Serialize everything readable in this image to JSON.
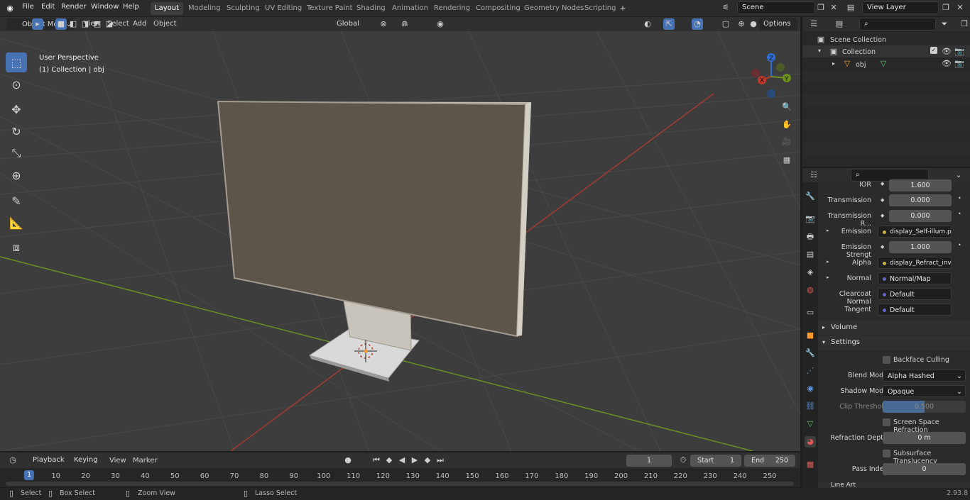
{
  "app": {
    "version": "2.93.8"
  },
  "menu": [
    "File",
    "Edit",
    "Render",
    "Window",
    "Help"
  ],
  "workspaces": [
    "Layout",
    "Modeling",
    "Sculpting",
    "UV Editing",
    "Texture Paint",
    "Shading",
    "Animation",
    "Rendering",
    "Compositing",
    "Geometry Nodes",
    "Scripting"
  ],
  "active_workspace": "Layout",
  "scene": {
    "name": "Scene",
    "view_layer": "View Layer"
  },
  "viewport_header": {
    "mode": "Object Mode",
    "menus": [
      "View",
      "Select",
      "Add",
      "Object"
    ],
    "orientation": "Global",
    "options": "Options"
  },
  "viewport": {
    "perspective": "User Perspective",
    "collection": "(1) Collection | obj",
    "gizmo": {
      "x": "X",
      "y": "Y",
      "z": "Z"
    }
  },
  "outliner": {
    "root": "Scene Collection",
    "collection": "Collection",
    "object": "obj"
  },
  "properties": {
    "rows": [
      {
        "label": "IOR",
        "value": "1.600",
        "type": "num"
      },
      {
        "label": "Transmission",
        "value": "0.000",
        "type": "num"
      },
      {
        "label": "Transmission R...",
        "value": "0.000",
        "type": "num"
      },
      {
        "label": "Emission",
        "value": "display_Self-illum.png",
        "type": "link",
        "color": "#c8b43a"
      },
      {
        "label": "Emission Strengt",
        "value": "1.000",
        "type": "num"
      },
      {
        "label": "Alpha",
        "value": "display_Refract_inv...",
        "type": "link",
        "color": "#c8b43a"
      },
      {
        "label": "Normal",
        "value": "Normal/Map",
        "type": "link",
        "color": "#6363c7"
      },
      {
        "label": "Clearcoat Normal",
        "value": "Default",
        "type": "link",
        "color": "#6363c7"
      },
      {
        "label": "Tangent",
        "value": "Default",
        "type": "link",
        "color": "#6363c7"
      }
    ],
    "sections": {
      "volume": "Volume",
      "settings": "Settings",
      "line_art": "Line Art"
    },
    "settings": {
      "backface_culling": "Backface Culling",
      "blend_mode_label": "Blend Mode",
      "blend_mode": "Alpha Hashed",
      "shadow_mode_label": "Shadow Mode",
      "shadow_mode": "Opaque",
      "clip_threshold_label": "Clip Threshold",
      "clip_threshold": "0.500",
      "ssr": "Screen Space Refraction",
      "refraction_depth_label": "Refraction Depth",
      "refraction_depth": "0 m",
      "sss": "Subsurface Translucency",
      "pass_index_label": "Pass Index",
      "pass_index": "0"
    }
  },
  "timeline": {
    "menus": [
      "Playback",
      "Keying",
      "View",
      "Marker"
    ],
    "current_frame": "1",
    "start_label": "Start",
    "start": "1",
    "end_label": "End",
    "end": "250",
    "ticks": [
      "1",
      "10",
      "20",
      "30",
      "40",
      "50",
      "60",
      "70",
      "80",
      "90",
      "100",
      "110",
      "120",
      "130",
      "140",
      "150",
      "160",
      "170",
      "180",
      "190",
      "200",
      "210",
      "220",
      "230",
      "240",
      "250"
    ]
  },
  "statusbar": {
    "select": "Select",
    "box_select": "Box Select",
    "zoom_view": "Zoom View",
    "lasso_select": "Lasso Select"
  },
  "colors": {
    "accent": "#4772b3",
    "x_axis": "#c0392b",
    "y_axis": "#6c8f1f",
    "z_axis": "#2d6fd1"
  }
}
